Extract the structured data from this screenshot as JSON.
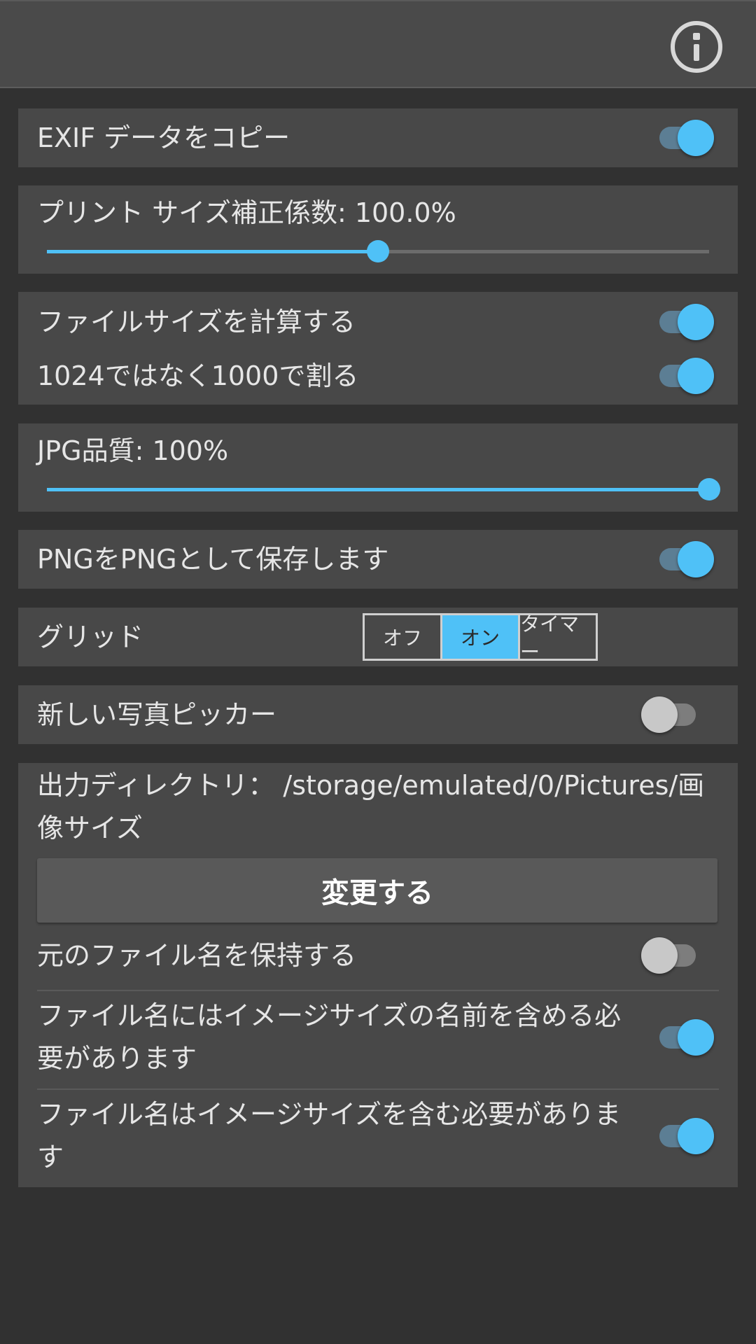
{
  "exif": {
    "label": "EXIF データをコピー",
    "on": true
  },
  "print_size": {
    "label": "プリント サイズ補正係数: 100.0%",
    "percent": 50
  },
  "file_size": {
    "calc_label": "ファイルサイズを計算する",
    "calc_on": true,
    "divide_label": "1024ではなく1000で割る",
    "divide_on": true
  },
  "jpg_quality": {
    "label": "JPG品質: 100%",
    "percent": 100
  },
  "png": {
    "label": "PNGをPNGとして保存します",
    "on": true
  },
  "grid": {
    "label": "グリッド",
    "options": [
      "オフ",
      "オン",
      "タイマー"
    ],
    "selected": "オン"
  },
  "photo_picker": {
    "label": "新しい写真ピッカー",
    "on": false
  },
  "output": {
    "directory_text": "出力ディレクトリ： /storage/emulated/0/Pictures/画像サイズ",
    "change_button": "変更する",
    "keep_original_label": "元のファイル名を保持する",
    "keep_original_on": false,
    "include_name_label": "ファイル名にはイメージサイズの名前を含める必要があります",
    "include_name_on": true,
    "include_size_label": "ファイル名はイメージサイズを含む必要があります",
    "include_size_on": true
  },
  "colors": {
    "accent": "#4fc1f7",
    "card": "#484848",
    "background": "#313131",
    "toolbar": "#4a4a4a"
  },
  "icons": {
    "toolbar_info": "info-icon"
  }
}
